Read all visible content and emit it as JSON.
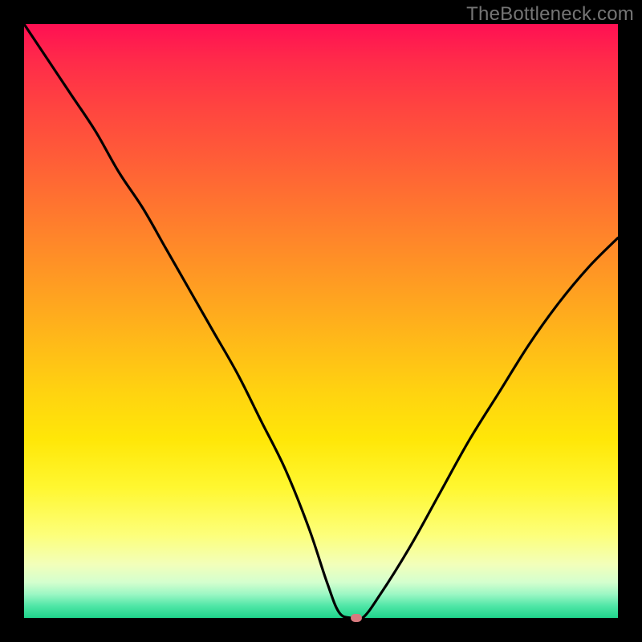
{
  "watermark": "TheBottleneck.com",
  "chart_data": {
    "type": "line",
    "title": "",
    "xlabel": "",
    "ylabel": "",
    "xlim": [
      0,
      100
    ],
    "ylim": [
      0,
      100
    ],
    "grid": false,
    "legend": false,
    "curve": {
      "name": "bottleneck-curve",
      "color": "#000000",
      "x": [
        0,
        4,
        8,
        12,
        16,
        20,
        24,
        28,
        32,
        36,
        40,
        44,
        48,
        51,
        53,
        55,
        57,
        60,
        65,
        70,
        75,
        80,
        85,
        90,
        95,
        100
      ],
      "y": [
        100,
        94,
        88,
        82,
        75,
        69,
        62,
        55,
        48,
        41,
        33,
        25,
        15,
        6,
        1,
        0,
        0,
        4,
        12,
        21,
        30,
        38,
        46,
        53,
        59,
        64
      ]
    },
    "marker": {
      "x": 56,
      "y": 0,
      "color": "#d97a7f"
    },
    "gradient": {
      "top": "#ff1053",
      "mid": "#ffd310",
      "bottom": "#1fd48c"
    }
  }
}
